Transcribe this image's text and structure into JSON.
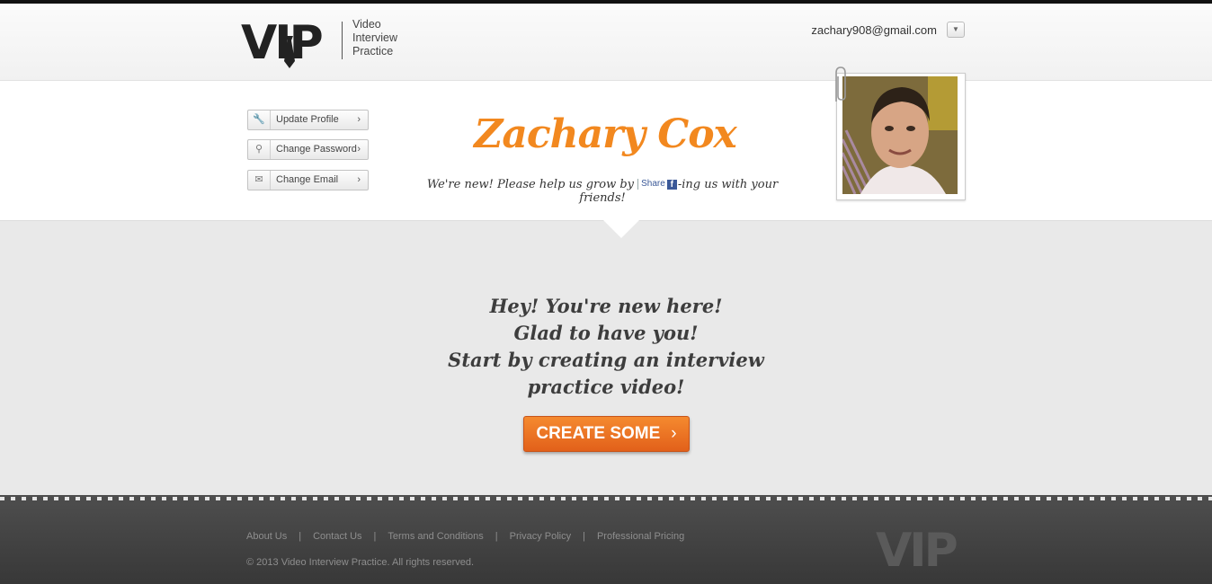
{
  "header": {
    "logo_mark": "VIP",
    "logo_text": [
      "Video",
      "Interview",
      "Practice"
    ],
    "user_email": "zachary908@gmail.com",
    "user_menu_icon": "chevron-down-icon"
  },
  "sidebar": {
    "buttons": [
      {
        "label": "Update Profile",
        "icon": "wrench-icon"
      },
      {
        "label": "Change Password",
        "icon": "key-icon"
      },
      {
        "label": "Change Email",
        "icon": "envelope-icon"
      }
    ]
  },
  "profile": {
    "name": "Zachary Cox",
    "share_prefix": "We're new! Please help us grow by",
    "share_button": "Share",
    "share_suffix": "-ing us with your friends!"
  },
  "main": {
    "welcome_lines": [
      "Hey! You're new here!",
      "Glad to have you!",
      "Start by creating an interview",
      "practice video!"
    ],
    "cta_label": "CREATE SOME",
    "cta_color": "#f0731f"
  },
  "footer": {
    "links": [
      "About Us",
      "Contact Us",
      "Terms and Conditions",
      "Privacy Policy",
      "Professional Pricing"
    ],
    "separator": "|",
    "copyright": "© 2013 Video Interview Practice. All rights reserved.",
    "logo_mark": "VIP"
  },
  "colors": {
    "accent": "#f2881f",
    "footer_bg": "#444444"
  }
}
